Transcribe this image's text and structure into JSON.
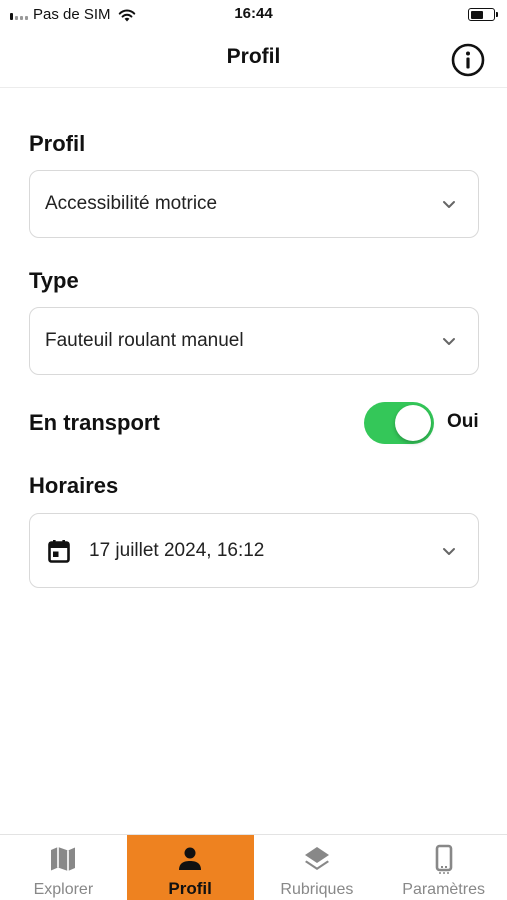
{
  "status_bar": {
    "carrier": "Pas de SIM",
    "time": "16:44",
    "battery_level": 0.58
  },
  "header": {
    "title": "Profil"
  },
  "form": {
    "profile_label": "Profil",
    "profile_value": "Accessibilité motrice",
    "type_label": "Type",
    "type_value": "Fauteuil roulant manuel",
    "transport_label": "En transport",
    "transport_toggle_on": true,
    "transport_state": "Oui",
    "schedule_label": "Horaires",
    "schedule_value": "17 juillet 2024, 16:12"
  },
  "tabbar": {
    "tabs": [
      {
        "label": "Explorer",
        "icon": "map-icon",
        "active": false
      },
      {
        "label": "Profil",
        "icon": "person-icon",
        "active": true
      },
      {
        "label": "Rubriques",
        "icon": "layers-icon",
        "active": false
      },
      {
        "label": "Paramètres",
        "icon": "phone-icon",
        "active": false
      }
    ]
  },
  "colors": {
    "accent": "#ee8220",
    "toggle_on": "#34c759"
  }
}
